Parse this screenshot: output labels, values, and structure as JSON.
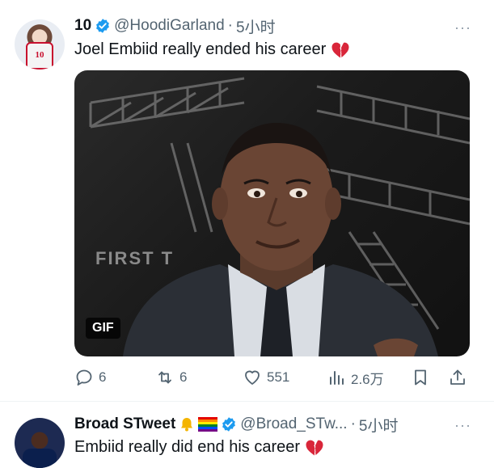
{
  "tweet1": {
    "display_name": "10",
    "handle": "@HoodiGarland",
    "separator": "·",
    "time": "5小时",
    "text": "Joel Embiid really ended his career",
    "avatar_jersey_number": "10",
    "media": {
      "badge": "GIF",
      "background_text": "FIRST T"
    },
    "actions": {
      "replies": "6",
      "retweets": "6",
      "likes": "551",
      "views": "2.6万"
    }
  },
  "tweet2": {
    "display_name": "Broad STweet",
    "name_emojis": [
      "bell-emoji",
      "rainbow-flag-emoji"
    ],
    "handle": "@Broad_STw...",
    "separator": "·",
    "time": "5小时",
    "text": "Embiid really did end his career"
  },
  "more_label": "···",
  "icons": {
    "verified": "verified-badge-icon",
    "broken_heart": "broken-heart-emoji",
    "reply": "reply-icon",
    "retweet": "retweet-icon",
    "like": "heart-icon",
    "views": "views-icon",
    "bookmark": "bookmark-icon",
    "share": "share-icon"
  },
  "colors": {
    "verified": "#1d9bf0",
    "secondary_text": "#536471",
    "broken_heart": "#d9263a"
  }
}
